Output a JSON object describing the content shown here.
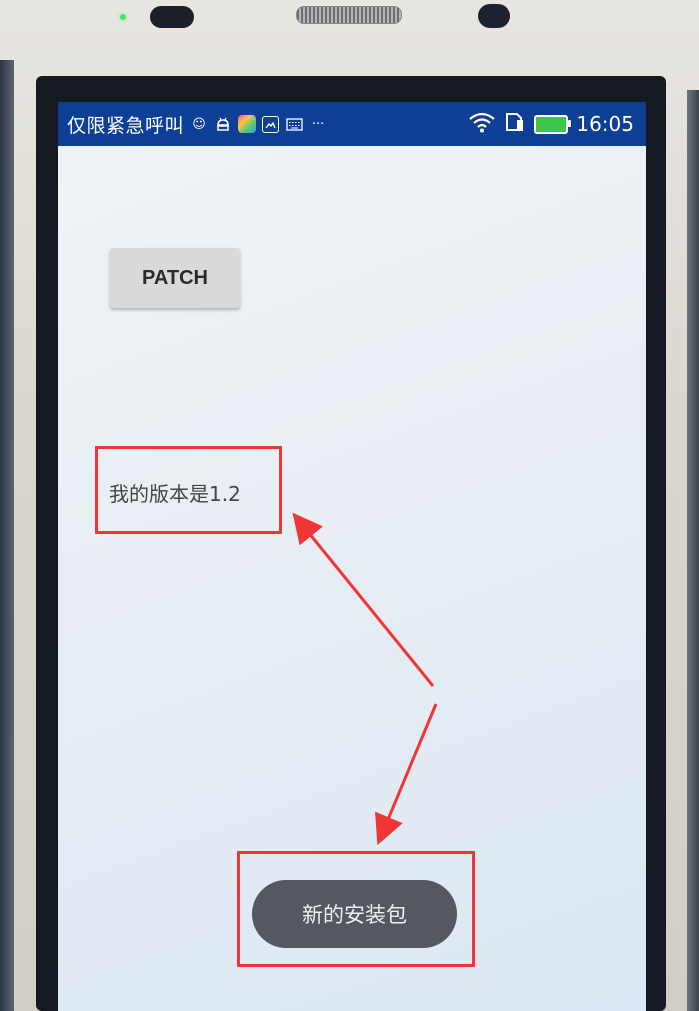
{
  "status_bar": {
    "carrier": "仅限紧急呼叫",
    "time": "16:05",
    "more_indicator": "···",
    "icons": [
      "face-icon",
      "android-icon",
      "app-icon",
      "image-icon",
      "keyboard-icon",
      "wifi-icon",
      "sim-icon",
      "battery-icon"
    ]
  },
  "app": {
    "patch_button_label": "PATCH",
    "version_text": "我的版本是1.2",
    "toast_text": "新的安装包"
  },
  "colors": {
    "status_bar": "#0d3f97",
    "annotation_red": "#f03535",
    "toast_bg": "#545860"
  }
}
